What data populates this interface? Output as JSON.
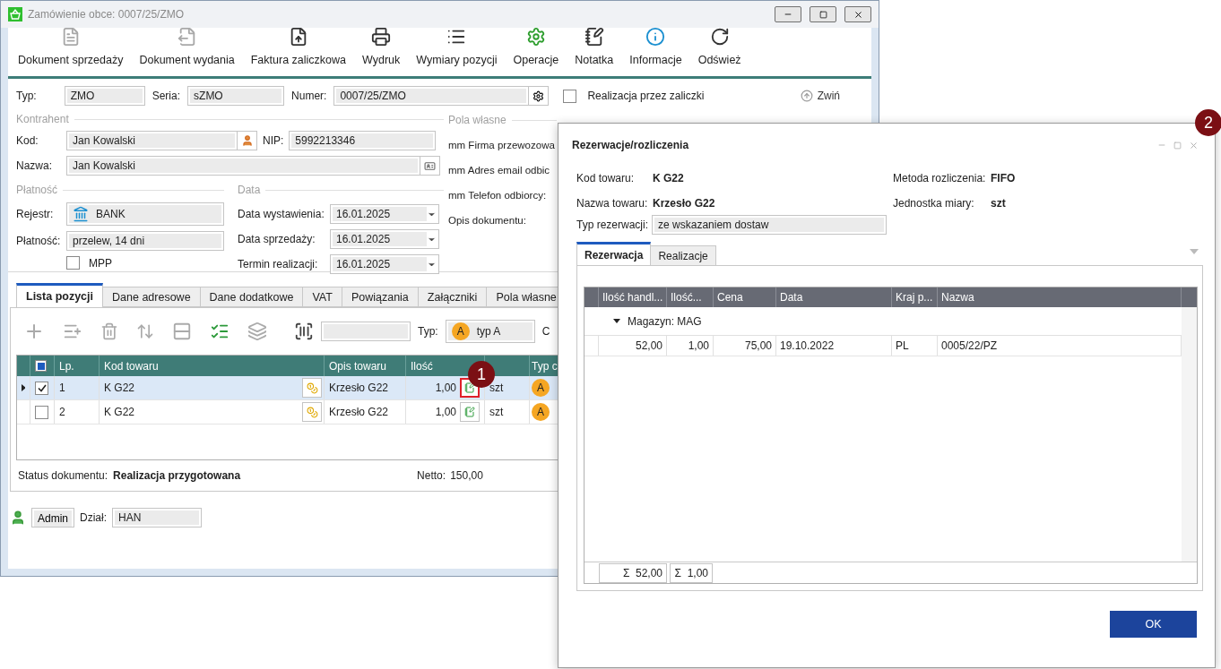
{
  "window": {
    "title": "Zamówienie obce: 0007/25/ZMO"
  },
  "toolbar": [
    {
      "label": "Dokument sprzedaży",
      "disabled": true
    },
    {
      "label": "Dokument wydania",
      "disabled": true
    },
    {
      "label": "Faktura zaliczkowa",
      "disabled": false
    },
    {
      "label": "Wydruk",
      "disabled": false
    },
    {
      "label": "Wymiary pozycji",
      "disabled": false
    },
    {
      "label": "Operacje",
      "disabled": false
    },
    {
      "label": "Notatka",
      "disabled": false
    },
    {
      "label": "Informacje",
      "disabled": false
    },
    {
      "label": "Odśwież",
      "disabled": false
    }
  ],
  "header": {
    "typ_label": "Typ:",
    "typ": "ZMO",
    "seria_label": "Seria:",
    "seria": "sZMO",
    "numer_label": "Numer:",
    "numer": "0007/25/ZMO",
    "realizacja": {
      "label": "Realizacja przez zaliczki",
      "checked": false
    },
    "collapse": "Zwiń"
  },
  "kontrahent": {
    "title": "Kontrahent",
    "kod_label": "Kod:",
    "kod": "Jan Kowalski",
    "nip_label": "NIP:",
    "nip": "5992213346",
    "nazwa_label": "Nazwa:",
    "nazwa": "Jan Kowalski"
  },
  "platnosc": {
    "title": "Płatność",
    "rejestr_label": "Rejestr:",
    "rejestr": "BANK",
    "platnosc_label": "Płatność:",
    "platnosc": "przelew, 14 dni",
    "mpp": {
      "label": "MPP",
      "checked": false
    }
  },
  "data": {
    "title": "Data",
    "fields": [
      {
        "label": "Data wystawienia:",
        "value": "16.01.2025"
      },
      {
        "label": "Data sprzedaży:",
        "value": "16.01.2025"
      },
      {
        "label": "Termin realizacji:",
        "value": "16.01.2025"
      }
    ]
  },
  "pola_wlasne": {
    "title": "Pola własne",
    "fields": [
      "mm Firma przewozowa",
      "mm Adres email odbic",
      "mm Telefon odbiorcy:",
      "Opis dokumentu:"
    ]
  },
  "tabs": [
    {
      "label": "Lista pozycji",
      "selected": true
    },
    {
      "label": "Dane adresowe",
      "selected": false
    },
    {
      "label": "Dane dodatkowe",
      "selected": false
    },
    {
      "label": "VAT",
      "selected": false
    },
    {
      "label": "Powiązania",
      "selected": false
    },
    {
      "label": "Załączniki",
      "selected": false
    },
    {
      "label": "Pola własne",
      "selected": false
    }
  ],
  "items_toolbar": {
    "typ_label": "Typ:",
    "typ_badge": "A",
    "typ_value": "typ A",
    "cut_label": "C"
  },
  "grid": {
    "select_all": {
      "partial": true,
      "checked": false
    },
    "columns": [
      "Lp.",
      "Kod towaru",
      "Opis towaru",
      "Ilość",
      "Typ c"
    ],
    "rows": [
      {
        "lp": "1",
        "kod": "K G22",
        "opis": "Krzesło G22",
        "ilosc": "1,00",
        "jm": "szt",
        "typ": "A",
        "checked": true,
        "selected": true,
        "marked": true
      },
      {
        "lp": "2",
        "kod": "K G22",
        "opis": "Krzesło G22",
        "ilosc": "1,00",
        "jm": "szt",
        "typ": "A",
        "checked": false,
        "selected": false,
        "marked": false
      }
    ]
  },
  "status": {
    "label": "Status dokumentu:",
    "value": "Realizacja przygotowana",
    "netto_label": "Netto:",
    "netto": "150,00"
  },
  "footer": {
    "user": "Admin",
    "dzial_label": "Dział:",
    "dzial": "HAN"
  },
  "dialog": {
    "title": "Rezerwacje/rozliczenia",
    "kod_label": "Kod towaru:",
    "kod": "K G22",
    "metoda_label": "Metoda rozliczenia:",
    "metoda": "FIFO",
    "nazwa_label": "Nazwa towaru:",
    "nazwa": "Krzesło G22",
    "jednostka_label": "Jednostka miary:",
    "jednostka": "szt",
    "typ_label": "Typ rezerwacji:",
    "typ": "ze wskazaniem dostaw",
    "tabs": [
      {
        "label": "Rezerwacja",
        "selected": true
      },
      {
        "label": "Realizacje",
        "selected": false
      }
    ],
    "columns": [
      "Ilość handl...",
      "Ilość...",
      "Cena",
      "Data",
      "Kraj p...",
      "Nazwa"
    ],
    "group": "Magazyn: MAG",
    "rows": [
      [
        "52,00",
        "1,00",
        "75,00",
        "19.10.2022",
        "PL",
        "0005/22/PZ"
      ]
    ],
    "sums": [
      "Σ  52,00",
      "Σ  1,00"
    ],
    "ok": "OK"
  },
  "callouts": [
    "1",
    "2"
  ]
}
